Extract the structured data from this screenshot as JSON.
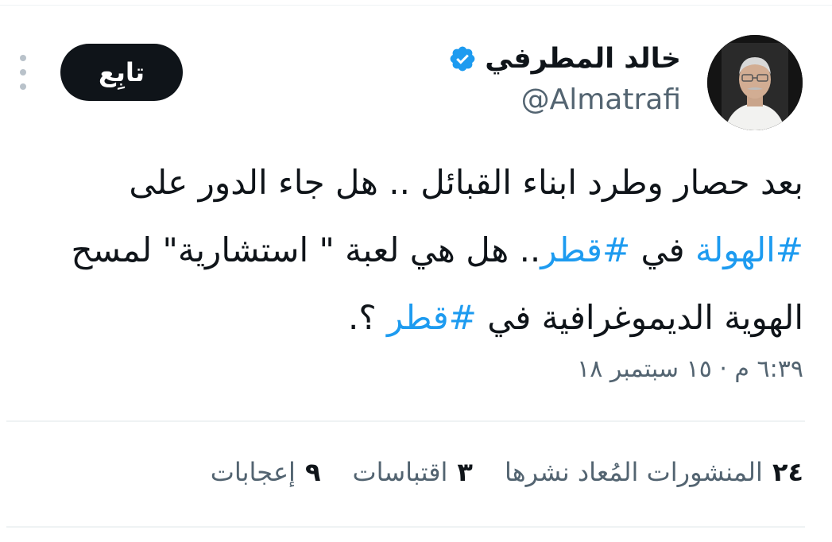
{
  "author": {
    "display_name": "خالد المطرفي",
    "handle": "@Almatrafi",
    "verified": true,
    "verified_color": "#1d9bf0"
  },
  "header": {
    "follow_label": "تابِع",
    "more_icon": "vertical-ellipsis-icon"
  },
  "tweet": {
    "segments": [
      {
        "text": "بعد حصار وطرد ابناء القبائل .. هل جاء الدور على ",
        "hashtag": false
      },
      {
        "text": "#الهولة",
        "hashtag": true
      },
      {
        "text": " في ",
        "hashtag": false
      },
      {
        "text": "#قطر",
        "hashtag": true
      },
      {
        "text": ".. هل هي لعبة \" استشارية\" لمسح الهوية الديموغرافية في ",
        "hashtag": false
      },
      {
        "text": "#قطر",
        "hashtag": true
      },
      {
        "text": " ؟.",
        "hashtag": false
      }
    ],
    "timestamp": "٦:٣٩ م · ١٥ سبتمبر ١٨",
    "hashtag_color": "#1d9bf0"
  },
  "stats": [
    {
      "count": "٢٤",
      "label": "المنشورات المُعاد نشرها"
    },
    {
      "count": "٣",
      "label": "اقتباسات"
    },
    {
      "count": "٩",
      "label": "إعجابات"
    }
  ]
}
